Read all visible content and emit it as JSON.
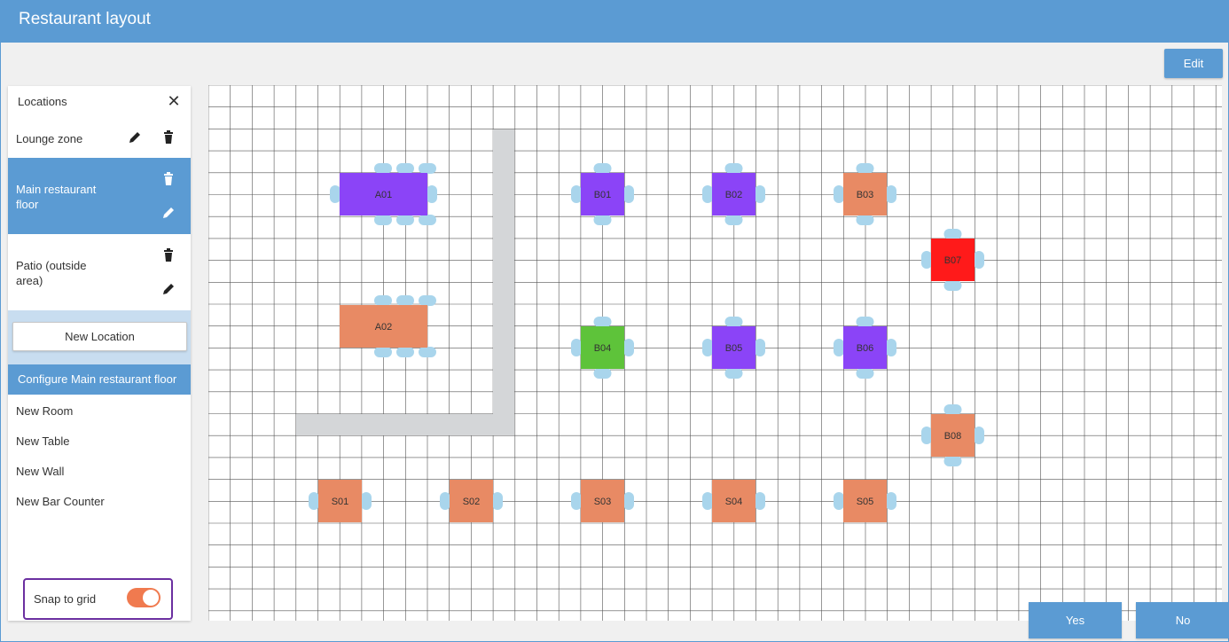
{
  "window": {
    "title": "Restaurant layout"
  },
  "toolbar": {
    "edit_label": "Edit"
  },
  "footer": {
    "yes_label": "Yes",
    "no_label": "No"
  },
  "sidebar": {
    "header": "Locations",
    "close_icon": "close-icon",
    "locations": [
      {
        "label": "Lounge zone",
        "selected": false
      },
      {
        "label": "Main restaurant\nfloor",
        "selected": true
      },
      {
        "label": "Patio (outside\narea)",
        "selected": false
      }
    ],
    "new_location_label": "New Location",
    "configure_header": "Configure Main restaurant floor",
    "configure_items": [
      "New Room",
      "New Table",
      "New Wall",
      "New Bar Counter"
    ],
    "snap": {
      "label": "Snap to grid",
      "enabled": true
    }
  },
  "colors": {
    "accent": "#5b9bd3",
    "purple_table": "#8b44f7",
    "orange_table": "#e88a64",
    "green_table": "#5ec33a",
    "red_table": "#ff1a1a",
    "chair": "#a9d5ec",
    "wall": "#d4d6d8",
    "toggle_on": "#f07a4f"
  },
  "tables": [
    {
      "id": "A01",
      "color": "#8b44f7"
    },
    {
      "id": "A02",
      "color": "#e88a64"
    },
    {
      "id": "B01",
      "color": "#8b44f7"
    },
    {
      "id": "B02",
      "color": "#8b44f7"
    },
    {
      "id": "B03",
      "color": "#e88a64"
    },
    {
      "id": "B07",
      "color": "#ff1a1a"
    },
    {
      "id": "B04",
      "color": "#5ec33a"
    },
    {
      "id": "B05",
      "color": "#8b44f7"
    },
    {
      "id": "B06",
      "color": "#8b44f7"
    },
    {
      "id": "B08",
      "color": "#e88a64"
    },
    {
      "id": "S01",
      "color": "#e88a64"
    },
    {
      "id": "S02",
      "color": "#e88a64"
    },
    {
      "id": "S03",
      "color": "#e88a64"
    },
    {
      "id": "S04",
      "color": "#e88a64"
    },
    {
      "id": "S05",
      "color": "#e88a64"
    }
  ]
}
